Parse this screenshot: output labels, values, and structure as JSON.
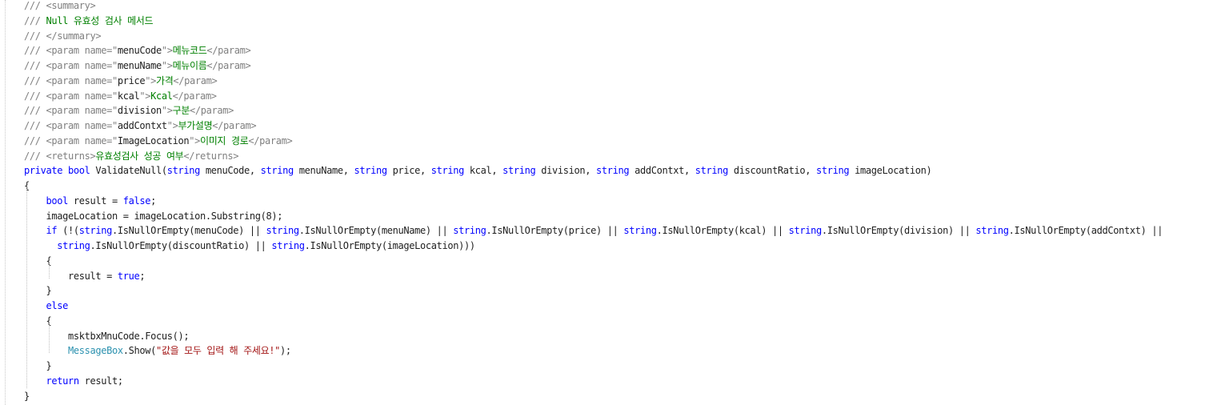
{
  "editor": {
    "lines": [
      [
        {
          "c": "g",
          "t": "/// <summary>"
        }
      ],
      [
        {
          "c": "g",
          "t": "/// "
        },
        {
          "c": "c",
          "t": "Null 유효성 검사 메서드"
        }
      ],
      [
        {
          "c": "g",
          "t": "/// </summary>"
        }
      ],
      [
        {
          "c": "g",
          "t": "/// <param name=\""
        },
        {
          "c": "p",
          "t": "menuCode"
        },
        {
          "c": "g",
          "t": "\">"
        },
        {
          "c": "c",
          "t": "메뉴코드"
        },
        {
          "c": "g",
          "t": "</param>"
        }
      ],
      [
        {
          "c": "g",
          "t": "/// <param name=\""
        },
        {
          "c": "p",
          "t": "menuName"
        },
        {
          "c": "g",
          "t": "\">"
        },
        {
          "c": "c",
          "t": "메뉴이름"
        },
        {
          "c": "g",
          "t": "</param>"
        }
      ],
      [
        {
          "c": "g",
          "t": "/// <param name=\""
        },
        {
          "c": "p",
          "t": "price"
        },
        {
          "c": "g",
          "t": "\">"
        },
        {
          "c": "c",
          "t": "가격"
        },
        {
          "c": "g",
          "t": "</param>"
        }
      ],
      [
        {
          "c": "g",
          "t": "/// <param name=\""
        },
        {
          "c": "p",
          "t": "kcal"
        },
        {
          "c": "g",
          "t": "\">"
        },
        {
          "c": "c",
          "t": "Kcal"
        },
        {
          "c": "g",
          "t": "</param>"
        }
      ],
      [
        {
          "c": "g",
          "t": "/// <param name=\""
        },
        {
          "c": "p",
          "t": "division"
        },
        {
          "c": "g",
          "t": "\">"
        },
        {
          "c": "c",
          "t": "구분"
        },
        {
          "c": "g",
          "t": "</param>"
        }
      ],
      [
        {
          "c": "g",
          "t": "/// <param name=\""
        },
        {
          "c": "p",
          "t": "addContxt"
        },
        {
          "c": "g",
          "t": "\">"
        },
        {
          "c": "c",
          "t": "부가설명"
        },
        {
          "c": "g",
          "t": "</param>"
        }
      ],
      [
        {
          "c": "g",
          "t": "/// <param name=\""
        },
        {
          "c": "p",
          "t": "ImageLocation"
        },
        {
          "c": "g",
          "t": "\">"
        },
        {
          "c": "c",
          "t": "이미지 경로"
        },
        {
          "c": "g",
          "t": "</param>"
        }
      ],
      [
        {
          "c": "g",
          "t": "/// <returns>"
        },
        {
          "c": "c",
          "t": "유효성검사 성공 여부"
        },
        {
          "c": "g",
          "t": "</returns>"
        }
      ],
      [
        {
          "c": "k",
          "t": "private"
        },
        {
          "c": "p",
          "t": " "
        },
        {
          "c": "k",
          "t": "bool"
        },
        {
          "c": "p",
          "t": " ValidateNull("
        },
        {
          "c": "k",
          "t": "string"
        },
        {
          "c": "p",
          "t": " menuCode, "
        },
        {
          "c": "k",
          "t": "string"
        },
        {
          "c": "p",
          "t": " menuName, "
        },
        {
          "c": "k",
          "t": "string"
        },
        {
          "c": "p",
          "t": " price, "
        },
        {
          "c": "k",
          "t": "string"
        },
        {
          "c": "p",
          "t": " kcal, "
        },
        {
          "c": "k",
          "t": "string"
        },
        {
          "c": "p",
          "t": " division, "
        },
        {
          "c": "k",
          "t": "string"
        },
        {
          "c": "p",
          "t": " addContxt, "
        },
        {
          "c": "k",
          "t": "string"
        },
        {
          "c": "p",
          "t": " discountRatio, "
        },
        {
          "c": "k",
          "t": "string"
        },
        {
          "c": "p",
          "t": " imageLocation)"
        }
      ],
      [
        {
          "c": "p",
          "t": "{"
        }
      ],
      [
        {
          "c": "p",
          "t": "    "
        },
        {
          "c": "k",
          "t": "bool"
        },
        {
          "c": "p",
          "t": " result = "
        },
        {
          "c": "k",
          "t": "false"
        },
        {
          "c": "p",
          "t": ";"
        }
      ],
      [
        {
          "c": "p",
          "t": "    imageLocation = imageLocation.Substring(8);"
        }
      ],
      [
        {
          "c": "p",
          "t": "    "
        },
        {
          "c": "k",
          "t": "if"
        },
        {
          "c": "p",
          "t": " (!("
        },
        {
          "c": "k",
          "t": "string"
        },
        {
          "c": "p",
          "t": ".IsNullOrEmpty(menuCode) || "
        },
        {
          "c": "k",
          "t": "string"
        },
        {
          "c": "p",
          "t": ".IsNullOrEmpty(menuName) || "
        },
        {
          "c": "k",
          "t": "string"
        },
        {
          "c": "p",
          "t": ".IsNullOrEmpty(price) || "
        },
        {
          "c": "k",
          "t": "string"
        },
        {
          "c": "p",
          "t": ".IsNullOrEmpty(kcal) || "
        },
        {
          "c": "k",
          "t": "string"
        },
        {
          "c": "p",
          "t": ".IsNullOrEmpty(division) || "
        },
        {
          "c": "k",
          "t": "string"
        },
        {
          "c": "p",
          "t": ".IsNullOrEmpty(addContxt) ||"
        }
      ],
      [
        {
          "c": "p",
          "t": "      "
        },
        {
          "c": "k",
          "t": "string"
        },
        {
          "c": "p",
          "t": ".IsNullOrEmpty(discountRatio) || "
        },
        {
          "c": "k",
          "t": "string"
        },
        {
          "c": "p",
          "t": ".IsNullOrEmpty(imageLocation)))"
        }
      ],
      [
        {
          "c": "p",
          "t": "    {"
        }
      ],
      [
        {
          "c": "p",
          "t": "        result = "
        },
        {
          "c": "k",
          "t": "true"
        },
        {
          "c": "p",
          "t": ";"
        }
      ],
      [
        {
          "c": "p",
          "t": "    }"
        }
      ],
      [
        {
          "c": "p",
          "t": "    "
        },
        {
          "c": "k",
          "t": "else"
        }
      ],
      [
        {
          "c": "p",
          "t": "    {"
        }
      ],
      [
        {
          "c": "p",
          "t": "        msktbxMnuCode.Focus();"
        }
      ],
      [
        {
          "c": "p",
          "t": "        "
        },
        {
          "c": "t",
          "t": "MessageBox"
        },
        {
          "c": "p",
          "t": ".Show("
        },
        {
          "c": "s",
          "t": "\"값을 모두 입력 해 주세요!\""
        },
        {
          "c": "p",
          "t": ");"
        }
      ],
      [
        {
          "c": "p",
          "t": "    }"
        }
      ],
      [
        {
          "c": "p",
          "t": "    "
        },
        {
          "c": "k",
          "t": "return"
        },
        {
          "c": "p",
          "t": " result;"
        }
      ],
      [
        {
          "c": "p",
          "t": "}"
        }
      ]
    ]
  }
}
